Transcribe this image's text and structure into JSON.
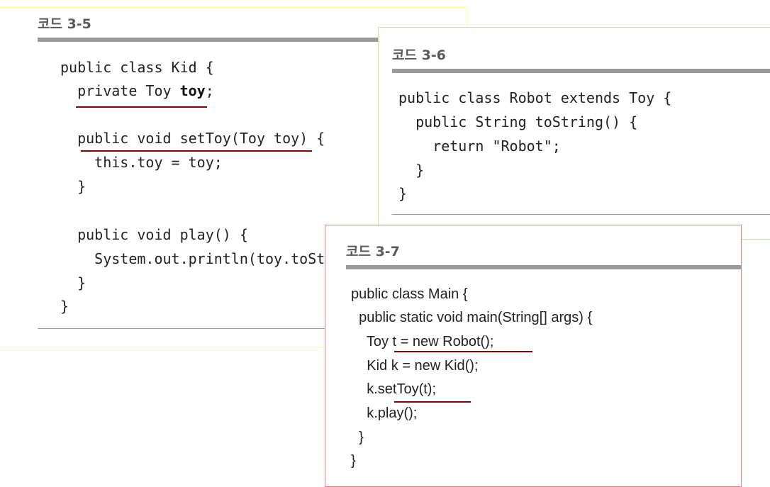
{
  "panel_35": {
    "title": "코드 3-5",
    "lines": [
      "public class Kid {",
      "  private Toy ",
      "toy",
      ";",
      "  public void setToy(Toy toy) {",
      "    this.toy = toy;",
      "  }",
      "  public void play() {",
      "    System.out.println(toy.toStr",
      "  }",
      "}"
    ]
  },
  "panel_36": {
    "title": "코드 3-6",
    "lines": [
      "public class Robot extends Toy {",
      "  public String toString() {",
      "    return \"Robot\";",
      "  }",
      "}"
    ]
  },
  "panel_37": {
    "title": "코드 3-7",
    "lines": [
      "public class Main {",
      "  public static void main(String[] args) {",
      "    Toy t = new Robot();",
      "    Kid k = new Kid();",
      "    k.setToy(t);",
      "    k.play();",
      "  }",
      "}"
    ]
  },
  "colors": {
    "panel_35_border": "#ffff99",
    "panel_36_border": "#c8e6a0",
    "panel_37_border": "#f08080",
    "underline": "#8b0000",
    "rule": "#9a9a9a",
    "title": "#5a5a5a"
  }
}
